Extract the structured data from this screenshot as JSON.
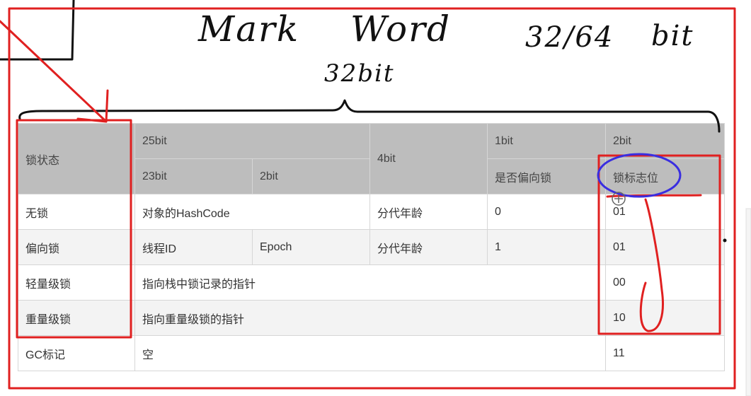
{
  "annotations": {
    "title_left": "Mark",
    "title_right": "Word",
    "size_label": "32/64",
    "bit_label": "bit",
    "width_label": "32bit"
  },
  "table": {
    "header": {
      "lock_state": "锁状态",
      "bits25": "25bit",
      "bits4": "4bit",
      "bits1": "1bit",
      "bits2": "2bit",
      "bits23": "23bit",
      "bits2b": "2bit",
      "biased_flag": "是否偏向锁",
      "lock_flag": "锁标志位"
    },
    "rows": [
      {
        "state": "无锁",
        "hash": "对象的HashCode",
        "age": "分代年龄",
        "biased": "0",
        "flag": "01"
      },
      {
        "state": "偏向锁",
        "thread": "线程ID",
        "epoch": "Epoch",
        "age": "分代年龄",
        "biased": "1",
        "flag": "01"
      },
      {
        "state": "轻量级锁",
        "pointer": "指向栈中锁记录的指针",
        "flag": "00"
      },
      {
        "state": "重量级锁",
        "pointer": "指向重量级锁的指针",
        "flag": "10"
      },
      {
        "state": "GC标记",
        "pointer": "空",
        "flag": "11"
      }
    ]
  },
  "colors": {
    "header_bg": "#bdbdbd",
    "row_alt_bg": "#f3f3f3",
    "border": "#d6d6d6",
    "red_ink": "#e02020",
    "blue_ink": "#3a2ee0"
  }
}
